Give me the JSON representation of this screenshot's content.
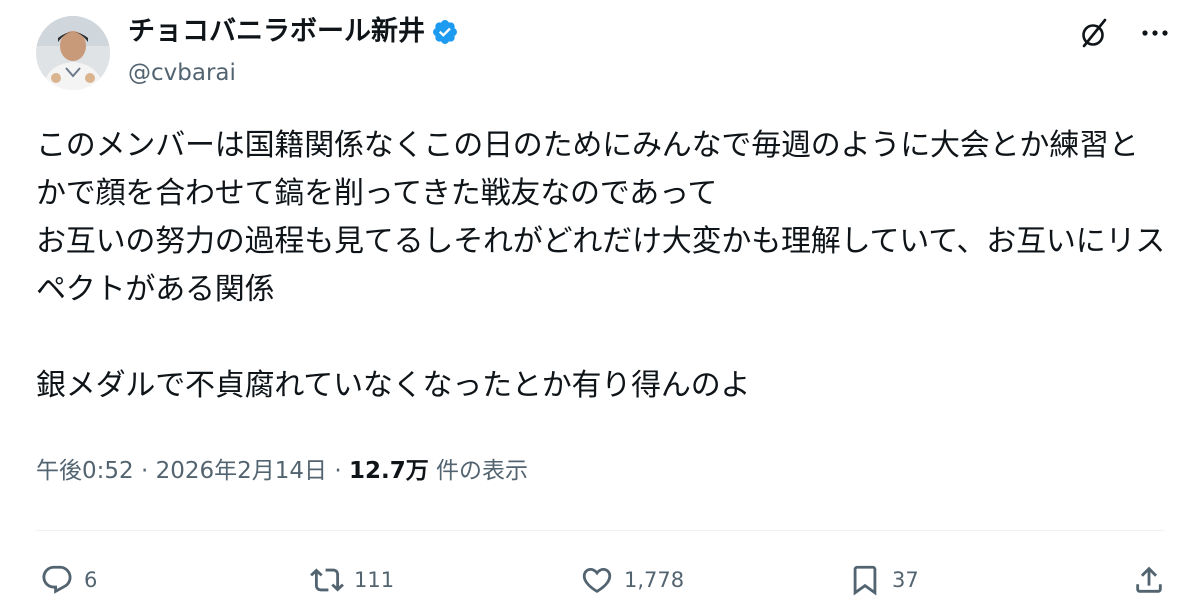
{
  "author": {
    "display_name": "チョコバニラボール新井",
    "handle": "@cvbarai",
    "verified": true,
    "avatar_icon": "profile-photo"
  },
  "header_actions": {
    "grok_icon": "grok-icon",
    "more_icon": "more-icon"
  },
  "tweet": {
    "text": "このメンバーは国籍関係なくこの日のためにみんなで毎週のように大会とか練習とかで顔を合わせて鎬を削ってきた戦友なのであって\nお互いの努力の過程も見てるしそれがどれだけ大変かも理解していて、お互いにリスペクトがある関係\n\n銀メダルで不貞腐れていなくなったとか有り得んのよ",
    "time": "午後0:52",
    "separator": "·",
    "date": "2026年2月14日",
    "views_count": "12.7万",
    "views_label": "件の表示"
  },
  "actions": {
    "reply_count": "6",
    "retweet_count": "111",
    "like_count": "1,778",
    "bookmark_count": "37"
  },
  "colors": {
    "text": "#0f1419",
    "secondary": "#536471",
    "verified_blue": "#1d9bf0",
    "divider": "#eff3f4"
  }
}
